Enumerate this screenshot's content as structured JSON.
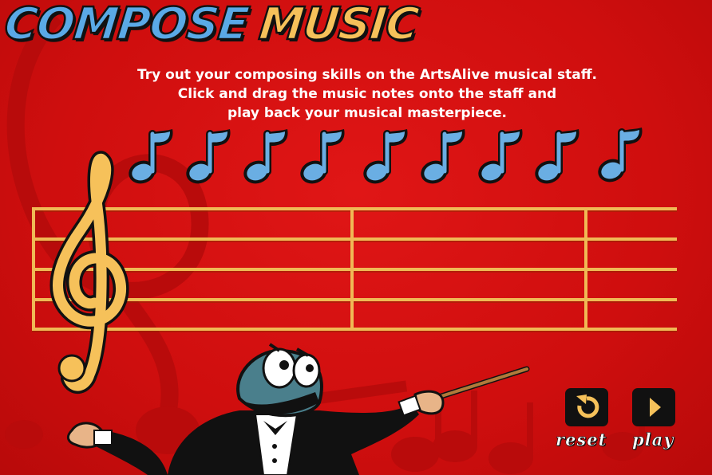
{
  "title": {
    "word1": "COMPOSE",
    "word2": "MUSIC"
  },
  "instructions": [
    "Try out your composing skills on the ArtsAlive musical staff.",
    "Click and drag the music notes onto the staff and",
    "play back your musical masterpiece."
  ],
  "palette": {
    "note_count": 9,
    "note_color": "#6aaee3",
    "note_type": "eighth-note"
  },
  "staff": {
    "line_count": 5,
    "measure_bar_count": 3,
    "clef": "treble",
    "color": "#f0b955"
  },
  "controls": {
    "reset_label": "reset",
    "play_label": "play"
  },
  "colors": {
    "background": "#d40f0f",
    "accent_blue": "#5aa9e6",
    "accent_gold": "#f6c15a"
  }
}
